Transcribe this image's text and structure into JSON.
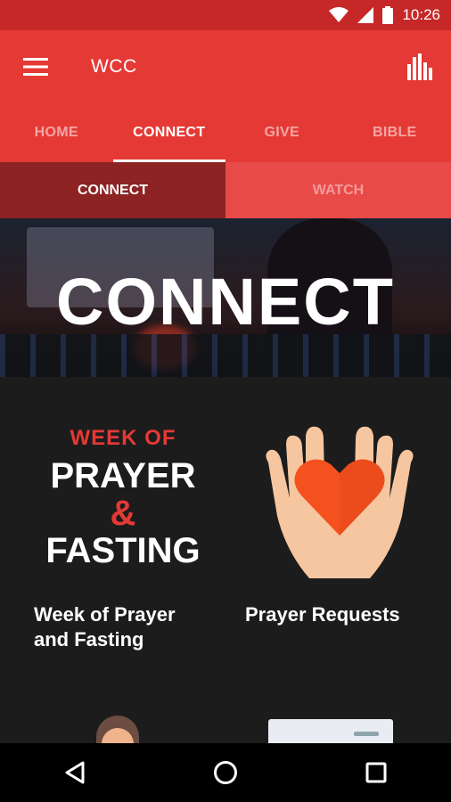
{
  "status": {
    "time": "10:26"
  },
  "app": {
    "title": "WCC"
  },
  "tabs": [
    {
      "label": "HOME"
    },
    {
      "label": "CONNECT"
    },
    {
      "label": "GIVE"
    },
    {
      "label": "BIBLE"
    }
  ],
  "subtabs": [
    {
      "label": "CONNECT"
    },
    {
      "label": "WATCH"
    }
  ],
  "hero": {
    "title": "CONNECT"
  },
  "cards": [
    {
      "image_text": {
        "line1": "WEEK OF",
        "line2": "PRAYER",
        "line3": "&",
        "line4": "FASTING"
      },
      "label": "Week of Prayer and Fasting"
    },
    {
      "icon": "heart-in-hands-icon",
      "label": "Prayer Requests"
    }
  ],
  "colors": {
    "primary": "#e53935",
    "status_bar": "#c62828",
    "subtab_active": "#8e2323",
    "background": "#1c1c1c"
  }
}
